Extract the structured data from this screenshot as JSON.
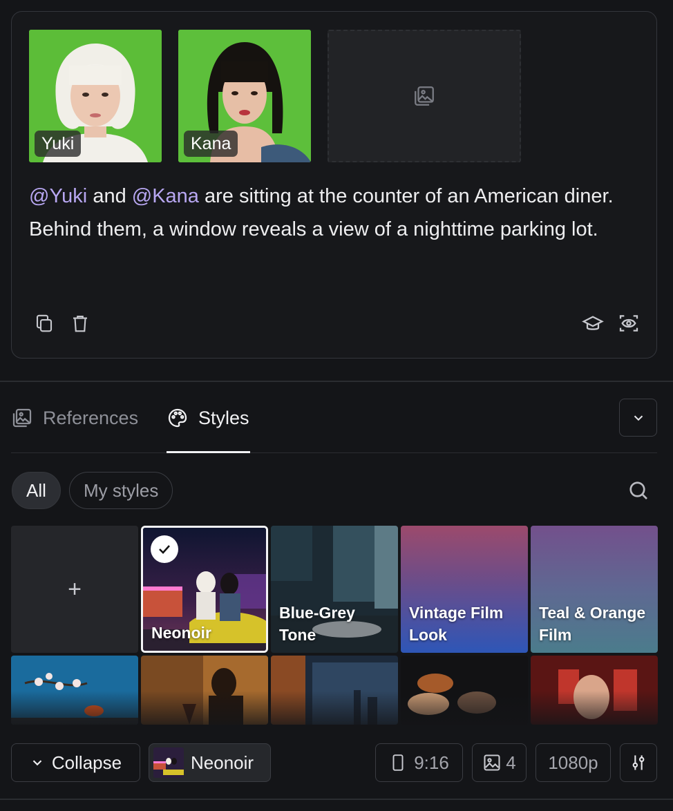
{
  "colors": {
    "background": "#141518",
    "mention": "#b8a7f2",
    "accent_underline": "#f2f2f4"
  },
  "characters": [
    {
      "name": "Yuki"
    },
    {
      "name": "Kana"
    }
  ],
  "empty_slot": {
    "icon": "image-upload-icon"
  },
  "prompt": {
    "mention1": "@Yuki",
    "text1": " and ",
    "mention2": "@Kana",
    "text2": " are sitting at the counter of an American diner. Behind them, a window reveals a view of a nighttime parking lot."
  },
  "card_actions": {
    "left": [
      "copy-icon",
      "trash-icon"
    ],
    "right": [
      "graduation-cap-icon",
      "eye-scan-icon"
    ]
  },
  "tabs": [
    {
      "label": "References",
      "icon": "images-icon",
      "active": false
    },
    {
      "label": "Styles",
      "icon": "palette-icon",
      "active": true
    }
  ],
  "filters": {
    "all": "All",
    "my_styles": "My styles"
  },
  "styles": {
    "add_label": "+",
    "row1": [
      {
        "label": "Neonoir",
        "selected": true
      },
      {
        "label": "Blue-Grey Tone"
      },
      {
        "label": "Vintage Film Look"
      },
      {
        "label": "Teal & Orange Film"
      }
    ]
  },
  "bottom_bar": {
    "collapse": "Collapse",
    "current_style": "Neonoir",
    "aspect": "9:16",
    "count": "4",
    "resolution": "1080p"
  }
}
